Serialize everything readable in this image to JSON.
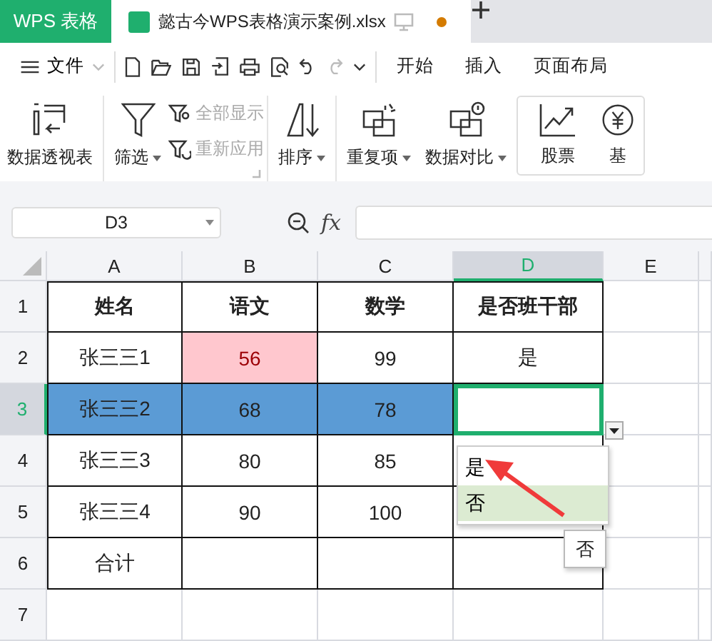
{
  "app_tab": {
    "label": "WPS 表格"
  },
  "file_tab": {
    "label": "懿古今WPS表格演示案例.xlsx",
    "unsaved": true
  },
  "quick_bar": {
    "menu_label": "文件",
    "tabs": [
      {
        "label": "开始",
        "selected": false
      },
      {
        "label": "插入",
        "selected": false
      },
      {
        "label": "页面布局",
        "selected": false
      }
    ]
  },
  "ribbon": {
    "items": [
      {
        "kind": "big",
        "label": "数据透视表",
        "dropdown": false,
        "disabled": false
      },
      {
        "kind": "big",
        "label": "筛选",
        "dropdown": true,
        "disabled": false
      },
      {
        "kind": "small",
        "label": "全部显示",
        "dropdown": false,
        "disabled": true
      },
      {
        "kind": "small",
        "label": "重新应用",
        "dropdown": false,
        "disabled": true
      },
      {
        "kind": "big",
        "label": "排序",
        "dropdown": true,
        "disabled": false
      },
      {
        "kind": "big",
        "label": "重复项",
        "dropdown": true,
        "disabled": false
      },
      {
        "kind": "big",
        "label": "数据对比",
        "dropdown": true,
        "disabled": false
      },
      {
        "kind": "boxed",
        "label": "股票",
        "dropdown": false,
        "disabled": false
      },
      {
        "kind": "boxed",
        "label": "基",
        "dropdown": false,
        "disabled": false
      }
    ]
  },
  "formula_bar": {
    "cell_ref": "D3",
    "function_label": "fx"
  },
  "sheet": {
    "columns": [
      {
        "label": "A",
        "selected": false
      },
      {
        "label": "B",
        "selected": false
      },
      {
        "label": "C",
        "selected": false
      },
      {
        "label": "D",
        "selected": true
      },
      {
        "label": "E",
        "selected": false
      }
    ],
    "rows": [
      {
        "label": "1",
        "selected": false,
        "in_table": true,
        "kind": "header",
        "cells": [
          {
            "text": "姓名"
          },
          {
            "text": "语文"
          },
          {
            "text": "数学"
          },
          {
            "text": "是否班干部"
          }
        ]
      },
      {
        "label": "2",
        "selected": false,
        "in_table": true,
        "kind": "data",
        "cells": [
          {
            "text": "张三三1"
          },
          {
            "text": "56",
            "highlighted": true
          },
          {
            "text": "99"
          },
          {
            "text": "是"
          }
        ]
      },
      {
        "label": "3",
        "selected": true,
        "in_table": true,
        "kind": "data",
        "cells": [
          {
            "text": "张三三2"
          },
          {
            "text": "68"
          },
          {
            "text": "78"
          },
          {
            "active": true
          }
        ]
      },
      {
        "label": "4",
        "selected": false,
        "in_table": true,
        "kind": "data",
        "cells": [
          {
            "text": "张三三3"
          },
          {
            "text": "80"
          },
          {
            "text": "85"
          },
          {}
        ]
      },
      {
        "label": "5",
        "selected": false,
        "in_table": true,
        "kind": "data",
        "cells": [
          {
            "text": "张三三4"
          },
          {
            "text": "90"
          },
          {
            "text": "100"
          },
          {}
        ]
      },
      {
        "label": "6",
        "selected": false,
        "in_table": true,
        "kind": "data",
        "cells": [
          {
            "text": "合计"
          },
          {},
          {},
          {}
        ]
      },
      {
        "label": "7",
        "selected": false,
        "in_table": false,
        "kind": "data",
        "cells": [
          {},
          {},
          {},
          {}
        ]
      }
    ]
  },
  "validation_list": {
    "items": [
      {
        "label": "是",
        "selected": false
      },
      {
        "label": "否",
        "selected": true
      }
    ],
    "tooltip": "否"
  }
}
